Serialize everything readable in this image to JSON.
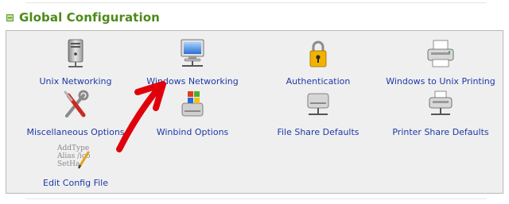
{
  "section": {
    "title": "Global Configuration",
    "toggle_icon": "collapse-toggle-icon"
  },
  "items": [
    {
      "label": "Unix Networking",
      "icon": "unix-server-icon"
    },
    {
      "label": "Windows Networking",
      "icon": "windows-network-icon"
    },
    {
      "label": "Authentication",
      "icon": "padlock-icon"
    },
    {
      "label": "Windows to Unix Printing",
      "icon": "printer-icon"
    },
    {
      "label": "Miscellaneous Options",
      "icon": "tools-icon"
    },
    {
      "label": "Winbind Options",
      "icon": "winbind-drive-icon"
    },
    {
      "label": "File Share Defaults",
      "icon": "file-share-drive-icon"
    },
    {
      "label": "Printer Share Defaults",
      "icon": "printer-share-icon"
    },
    {
      "label": "Edit Config File",
      "icon": "config-file-icon",
      "icon_text": [
        "AddType",
        "Alias /ico",
        "SetHa"
      ]
    }
  ],
  "colors": {
    "section_title": "#4d8a19",
    "link": "#1d3aa7",
    "panel_bg": "#efefef",
    "annotation_arrow": "#e0000b"
  }
}
